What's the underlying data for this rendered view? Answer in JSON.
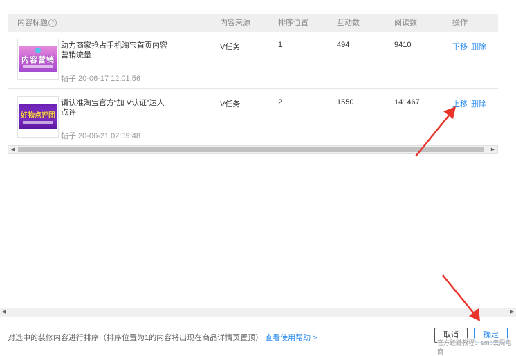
{
  "table": {
    "headers": {
      "title": "内容标题",
      "source": "内容来源",
      "position": "排序位置",
      "interactions": "互动数",
      "reads": "阅读数",
      "actions": "操作"
    },
    "rows": [
      {
        "thumb_text": "内容营销",
        "title": "助力商家抢占手机淘宝首页内容营销流量",
        "meta": "帖子 20-06-17 12:01:56",
        "source": "V任务",
        "position": "1",
        "interactions": "494",
        "reads": "9410",
        "action_move": "下移",
        "action_delete": "删除"
      },
      {
        "thumb_text": "好物点评团",
        "title": "请认准淘宝官方“加 V认证”达人点评",
        "meta": "帖子 20-06-21 02:59:48",
        "source": "V任务",
        "position": "2",
        "interactions": "1550",
        "reads": "141467",
        "action_move": "上移",
        "action_delete": "删除"
      }
    ]
  },
  "footer": {
    "description": "对选中的装修内容进行排序（排序位置为1的内容将出现在商品详情页置顶）",
    "help_link": "查看使用帮助 >",
    "cancel_label": "取消",
    "ok_label": "确定",
    "watermark": "官方跬跬教程：amp云周电商"
  },
  "colors": {
    "accent": "#2d8cf0",
    "annotation_arrow": "#e8342a",
    "header_bg": "#efefef"
  },
  "icons": {
    "help": "question-circle-icon",
    "scroll_left": "triangle-left-icon",
    "scroll_right": "triangle-right-icon"
  }
}
